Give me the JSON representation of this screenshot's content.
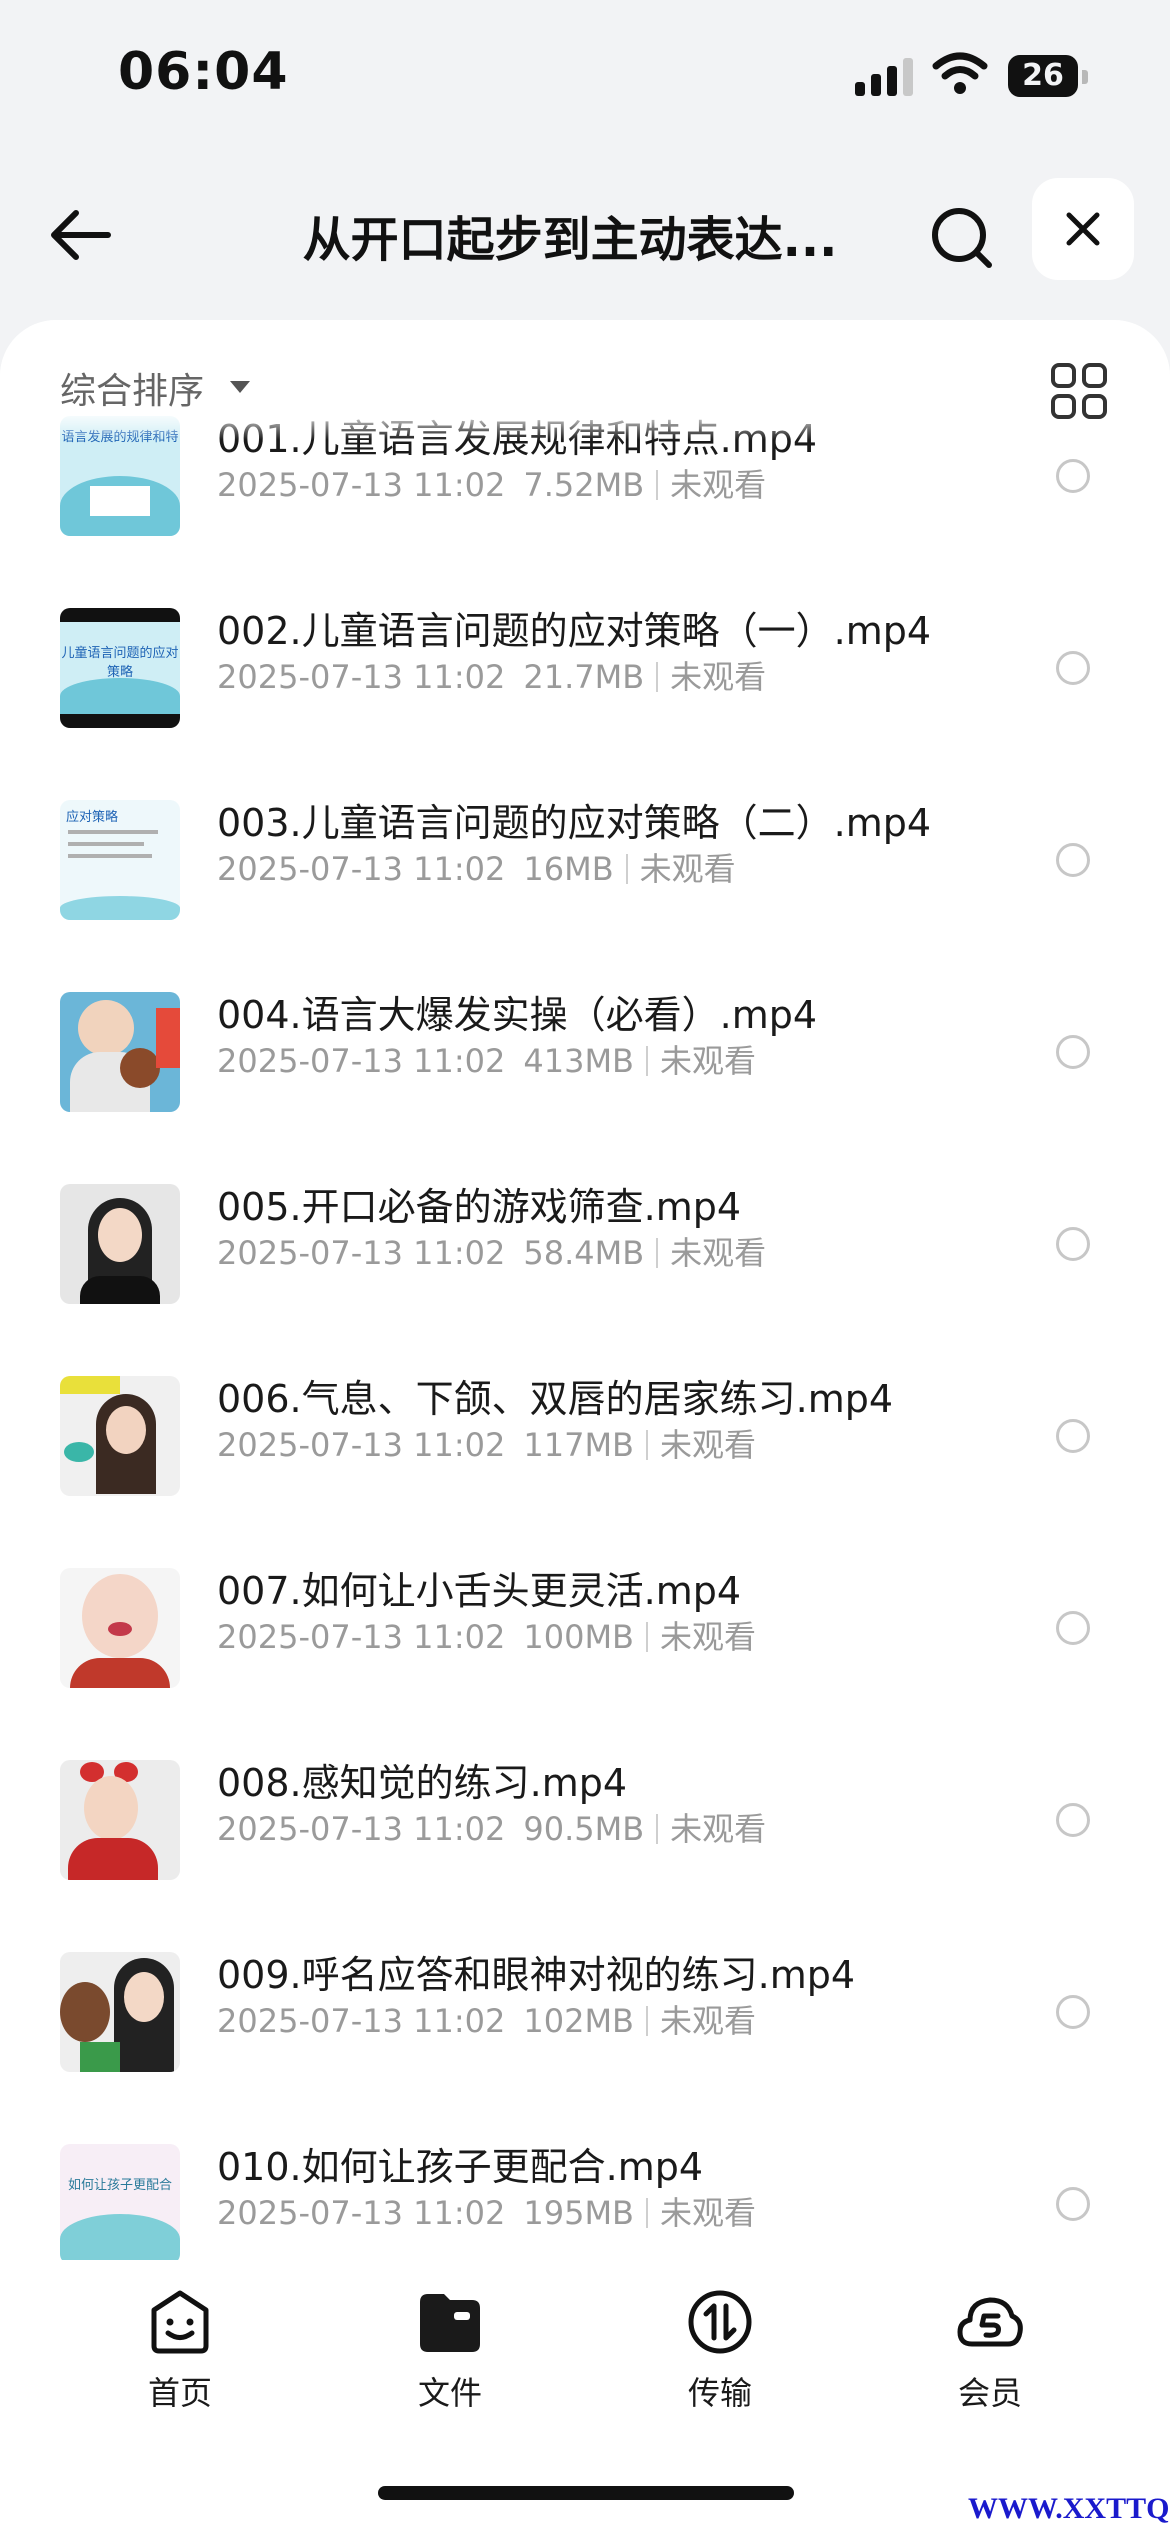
{
  "status_bar": {
    "time": "06:04",
    "battery": "26"
  },
  "header": {
    "title": "从开口起步到主动表达..."
  },
  "sort": {
    "label": "综合排序"
  },
  "files": [
    {
      "name": "001.儿童语言发展规律和特点.mp4",
      "date": "2025-07-13 11:02",
      "size": "7.52MB",
      "status": "未观看",
      "thumb_caption": "语言发展的规律和特"
    },
    {
      "name": "002.儿童语言问题的应对策略（一）.mp4",
      "date": "2025-07-13 11:02",
      "size": "21.7MB",
      "status": "未观看",
      "thumb_caption": "儿童语言问题的应对策略"
    },
    {
      "name": "003.儿童语言问题的应对策略（二）.mp4",
      "date": "2025-07-13 11:02",
      "size": "16MB",
      "status": "未观看",
      "thumb_caption": "应对策略"
    },
    {
      "name": "004.语言大爆发实操（必看）.mp4",
      "date": "2025-07-13 11:02",
      "size": "413MB",
      "status": "未观看",
      "thumb_caption": ""
    },
    {
      "name": "005.开口必备的游戏筛查.mp4",
      "date": "2025-07-13 11:02",
      "size": "58.4MB",
      "status": "未观看",
      "thumb_caption": ""
    },
    {
      "name": "006.气息、下颌、双唇的居家练习.mp4",
      "date": "2025-07-13 11:02",
      "size": "117MB",
      "status": "未观看",
      "thumb_caption": ""
    },
    {
      "name": "007.如何让小舌头更灵活.mp4",
      "date": "2025-07-13 11:02",
      "size": "100MB",
      "status": "未观看",
      "thumb_caption": ""
    },
    {
      "name": "008.感知觉的练习.mp4",
      "date": "2025-07-13 11:02",
      "size": "90.5MB",
      "status": "未观看",
      "thumb_caption": ""
    },
    {
      "name": "009.呼名应答和眼神对视的练习.mp4",
      "date": "2025-07-13 11:02",
      "size": "102MB",
      "status": "未观看",
      "thumb_caption": ""
    },
    {
      "name": "010.如何让孩子更配合.mp4",
      "date": "2025-07-13 11:02",
      "size": "195MB",
      "status": "未观看",
      "thumb_caption": "如何让孩子更配合"
    }
  ],
  "tabs": [
    {
      "label": "首页",
      "icon": "home-face-icon"
    },
    {
      "label": "文件",
      "icon": "folder-icon"
    },
    {
      "label": "传输",
      "icon": "transfer-icon"
    },
    {
      "label": "会员",
      "icon": "vip-cloud-icon"
    }
  ],
  "watermark": "WWW.XXTTQ.COM"
}
